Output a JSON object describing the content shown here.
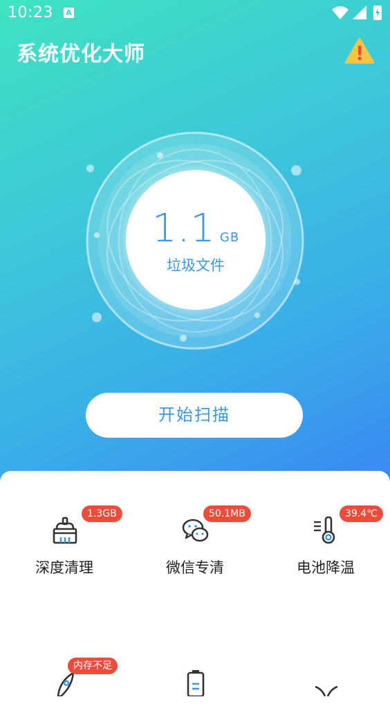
{
  "status_bar": {
    "time": "10:23",
    "notification_letter": "A"
  },
  "header": {
    "title": "系统优化大师"
  },
  "orb": {
    "value": "1.1",
    "unit": "GB",
    "label": "垃圾文件"
  },
  "scan_button": {
    "label": "开始扫描"
  },
  "tools": [
    {
      "label": "深度清理",
      "badge": "1.3GB",
      "icon": "broom-icon"
    },
    {
      "label": "微信专清",
      "badge": "50.1MB",
      "icon": "wechat-icon"
    },
    {
      "label": "电池降温",
      "badge": "39.4℃",
      "icon": "thermometer-icon"
    },
    {
      "label": "",
      "badge": "内存不足",
      "icon": "rocket-icon"
    },
    {
      "label": "",
      "badge": "",
      "icon": "battery-icon"
    },
    {
      "label": "",
      "badge": "",
      "icon": "fan-icon"
    }
  ],
  "colors": {
    "accent": "#3a97e8",
    "badge": "#ee4c3a",
    "gradient_start": "#3fe3c1",
    "gradient_end": "#3a86f3"
  }
}
